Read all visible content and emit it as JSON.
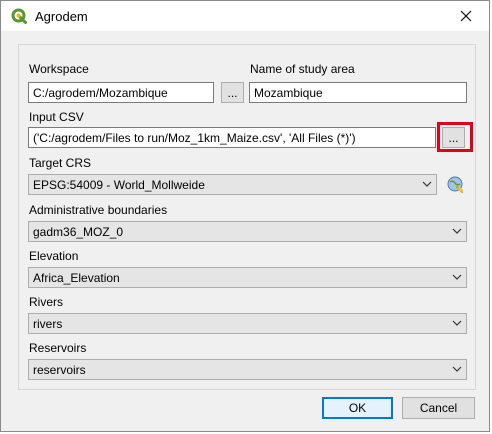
{
  "window": {
    "title": "Agrodem"
  },
  "workspace": {
    "label": "Workspace",
    "value": "C:/agrodem/Mozambique",
    "browse_label": "..."
  },
  "study_area": {
    "label": "Name of study area",
    "value": "Mozambique"
  },
  "input_csv": {
    "label": "Input CSV",
    "value": "('C:/agrodem/Files to run/Moz_1km_Maize.csv', 'All Files (*)')",
    "browse_label": "..."
  },
  "target_crs": {
    "label": "Target CRS",
    "value": "EPSG:54009 - World_Mollweide"
  },
  "admin_boundaries": {
    "label": "Administrative boundaries",
    "value": "gadm36_MOZ_0"
  },
  "elevation": {
    "label": "Elevation",
    "value": "Africa_Elevation"
  },
  "rivers": {
    "label": "Rivers",
    "value": "rivers"
  },
  "reservoirs": {
    "label": "Reservoirs",
    "value": "reservoirs"
  },
  "buttons": {
    "ok": "OK",
    "cancel": "Cancel"
  },
  "colors": {
    "highlight": "#e0001c",
    "qgis_green": "#589632",
    "default_button_border": "#0078d7"
  }
}
